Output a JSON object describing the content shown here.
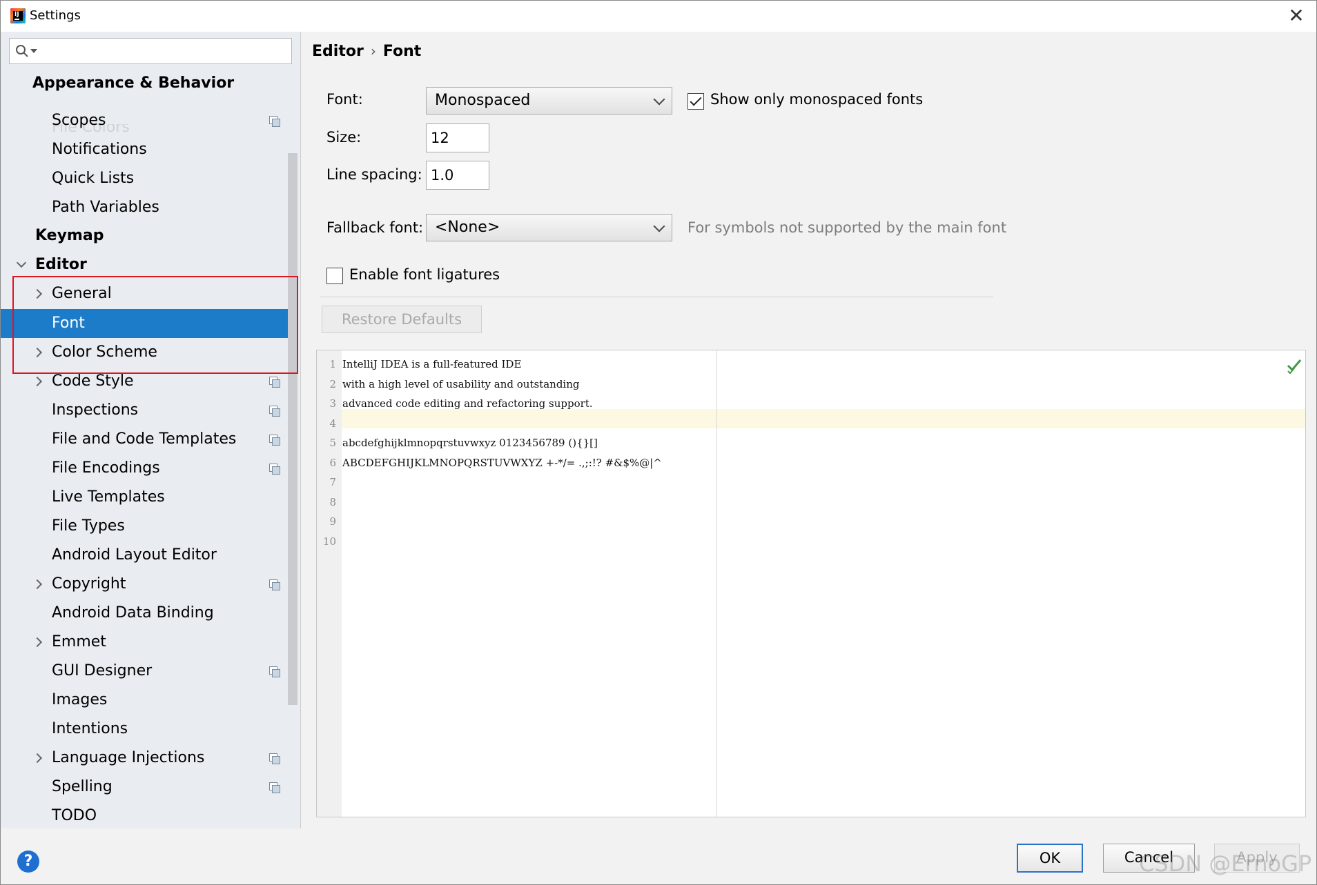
{
  "window": {
    "title": "Settings"
  },
  "search": {
    "placeholder": ""
  },
  "sidebar": {
    "partial_top": "File Colors",
    "items": [
      {
        "label": "Appearance & Behavior",
        "bold": true,
        "indent": 0,
        "expander": "none",
        "copy": false
      },
      {
        "label": "Scopes",
        "bold": false,
        "indent": 2,
        "expander": "none",
        "copy": true
      },
      {
        "label": "Notifications",
        "bold": false,
        "indent": 2,
        "expander": "none",
        "copy": false
      },
      {
        "label": "Quick Lists",
        "bold": false,
        "indent": 2,
        "expander": "none",
        "copy": false
      },
      {
        "label": "Path Variables",
        "bold": false,
        "indent": 2,
        "expander": "none",
        "copy": false
      },
      {
        "label": "Keymap",
        "bold": true,
        "indent": 1,
        "expander": "none",
        "copy": false
      },
      {
        "label": "Editor",
        "bold": true,
        "indent": 1,
        "expander": "down",
        "copy": false
      },
      {
        "label": "General",
        "bold": false,
        "indent": 2,
        "expander": "right",
        "copy": false
      },
      {
        "label": "Font",
        "bold": false,
        "indent": 2,
        "expander": "none",
        "copy": false,
        "selected": true
      },
      {
        "label": "Color Scheme",
        "bold": false,
        "indent": 2,
        "expander": "right",
        "copy": false
      },
      {
        "label": "Code Style",
        "bold": false,
        "indent": 2,
        "expander": "right",
        "copy": true
      },
      {
        "label": "Inspections",
        "bold": false,
        "indent": 2,
        "expander": "none",
        "copy": true
      },
      {
        "label": "File and Code Templates",
        "bold": false,
        "indent": 2,
        "expander": "none",
        "copy": true
      },
      {
        "label": "File Encodings",
        "bold": false,
        "indent": 2,
        "expander": "none",
        "copy": true
      },
      {
        "label": "Live Templates",
        "bold": false,
        "indent": 2,
        "expander": "none",
        "copy": false
      },
      {
        "label": "File Types",
        "bold": false,
        "indent": 2,
        "expander": "none",
        "copy": false
      },
      {
        "label": "Android Layout Editor",
        "bold": false,
        "indent": 2,
        "expander": "none",
        "copy": false
      },
      {
        "label": "Copyright",
        "bold": false,
        "indent": 2,
        "expander": "right",
        "copy": true
      },
      {
        "label": "Android Data Binding",
        "bold": false,
        "indent": 2,
        "expander": "none",
        "copy": false
      },
      {
        "label": "Emmet",
        "bold": false,
        "indent": 2,
        "expander": "right",
        "copy": false
      },
      {
        "label": "GUI Designer",
        "bold": false,
        "indent": 2,
        "expander": "none",
        "copy": true
      },
      {
        "label": "Images",
        "bold": false,
        "indent": 2,
        "expander": "none",
        "copy": false
      },
      {
        "label": "Intentions",
        "bold": false,
        "indent": 2,
        "expander": "none",
        "copy": false
      },
      {
        "label": "Language Injections",
        "bold": false,
        "indent": 2,
        "expander": "right",
        "copy": true
      },
      {
        "label": "Spelling",
        "bold": false,
        "indent": 2,
        "expander": "none",
        "copy": true
      },
      {
        "label": "TODO",
        "bold": false,
        "indent": 2,
        "expander": "none",
        "copy": false
      }
    ]
  },
  "breadcrumb": {
    "parent": "Editor",
    "separator": "›",
    "current": "Font"
  },
  "form": {
    "font_label": "Font:",
    "font_value": "Monospaced",
    "monospaced_only_label": "Show only monospaced fonts",
    "monospaced_only_checked": true,
    "size_label": "Size:",
    "size_value": "12",
    "line_spacing_label": "Line spacing:",
    "line_spacing_value": "1.0",
    "fallback_label": "Fallback font:",
    "fallback_value": "<None>",
    "fallback_hint": "For symbols not supported by the main font",
    "ligatures_label": "Enable font ligatures",
    "ligatures_checked": false,
    "restore_defaults_label": "Restore Defaults"
  },
  "preview": {
    "lines": [
      {
        "n": "1",
        "text": "IntelliJ IDEA is a full-featured IDE"
      },
      {
        "n": "2",
        "text": "with a high level of usability and outstanding"
      },
      {
        "n": "3",
        "text": "advanced code editing and refactoring support."
      },
      {
        "n": "4",
        "text": ""
      },
      {
        "n": "5",
        "text": "abcdefghijklmnopqrstuvwxyz 0123456789 (){}[]"
      },
      {
        "n": "6",
        "text": "ABCDEFGHIJKLMNOPQRSTUVWXYZ +-*/= .,;:!? #&$%@|^"
      },
      {
        "n": "7",
        "text": ""
      },
      {
        "n": "8",
        "text": ""
      },
      {
        "n": "9",
        "text": ""
      },
      {
        "n": "10",
        "text": ""
      }
    ]
  },
  "footer": {
    "help_label": "?",
    "ok_label": "OK",
    "cancel_label": "Cancel",
    "apply_label": "Apply"
  },
  "watermark": "CSDN @ErnoGP",
  "colors": {
    "selection": "#1d7cc9",
    "highlight_box": "#e0141f",
    "current_line": "#fdf8e2"
  }
}
